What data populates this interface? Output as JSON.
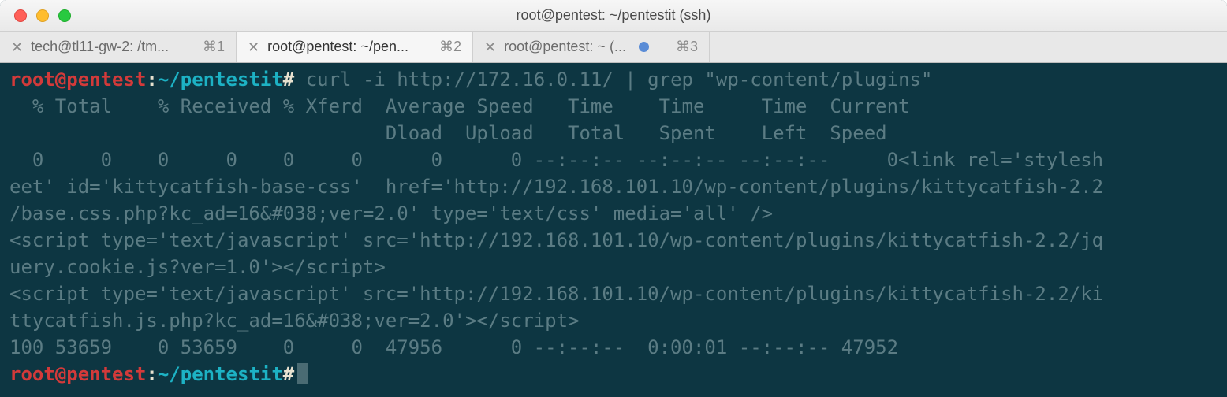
{
  "window": {
    "title": "root@pentest: ~/pentestit (ssh)"
  },
  "tabs": [
    {
      "label": "tech@tl11-gw-2: /tm...",
      "shortcut": "⌘1",
      "modified": false,
      "active": false
    },
    {
      "label": "root@pentest: ~/pen...",
      "shortcut": "⌘2",
      "modified": false,
      "active": true
    },
    {
      "label": "root@pentest: ~ (...",
      "shortcut": "⌘3",
      "modified": true,
      "active": false
    }
  ],
  "prompt": {
    "user": "root@pentest",
    "path": "~/pentestit",
    "sep1": ":",
    "sep2": "#",
    "space": " "
  },
  "command": "curl -i http://172.16.0.11/ | grep \"wp-content/plugins\"",
  "output": [
    "  % Total    % Received % Xferd  Average Speed   Time    Time     Time  Current",
    "                                 Dload  Upload   Total   Spent    Left  Speed",
    "  0     0    0     0    0     0      0      0 --:--:-- --:--:-- --:--:--     0<link rel='stylesh",
    "eet' id='kittycatfish-base-css'  href='http://192.168.101.10/wp-content/plugins/kittycatfish-2.2",
    "/base.css.php?kc_ad=16&#038;ver=2.0' type='text/css' media='all' />",
    "<script type='text/javascript' src='http://192.168.101.10/wp-content/plugins/kittycatfish-2.2/jq",
    "uery.cookie.js?ver=1.0'></script>",
    "<script type='text/javascript' src='http://192.168.101.10/wp-content/plugins/kittycatfish-2.2/ki",
    "ttycatfish.js.php?kc_ad=16&#038;ver=2.0'></script>",
    "100 53659    0 53659    0     0  47956      0 --:--:--  0:00:01 --:--:-- 47952"
  ]
}
